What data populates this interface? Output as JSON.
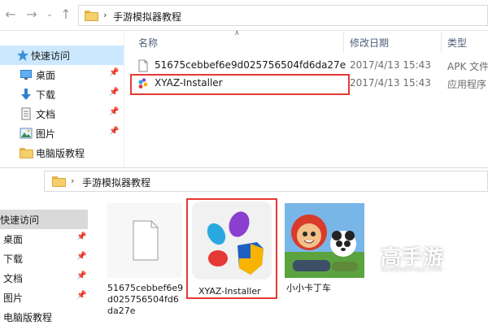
{
  "top_window": {
    "path": "手游模拟器教程",
    "nav": [
      {
        "label": "快速访问",
        "icon": "star-icon",
        "pinned": false
      },
      {
        "label": "桌面",
        "icon": "desktop-icon",
        "pinned": true
      },
      {
        "label": "下载",
        "icon": "download-icon",
        "pinned": true
      },
      {
        "label": "文档",
        "icon": "document-icon",
        "pinned": true
      },
      {
        "label": "图片",
        "icon": "picture-icon",
        "pinned": true
      },
      {
        "label": "电脑版教程",
        "icon": "folder-icon",
        "pinned": false
      }
    ],
    "columns": {
      "name": "名称",
      "date": "修改日期",
      "type": "类型"
    },
    "files": [
      {
        "name": "51675cebbef6e9d025756504fd6da27e",
        "date": "2017/4/13 15:43",
        "type": "APK 文件"
      },
      {
        "name": "XYAZ-Installer",
        "date": "2017/4/13 15:43",
        "type": "应用程序"
      }
    ]
  },
  "bottom_window": {
    "path": "手游模拟器教程",
    "nav": [
      {
        "label": "快速访问",
        "pinned": false
      },
      {
        "label": "桌面",
        "pinned": true
      },
      {
        "label": "下载",
        "pinned": true
      },
      {
        "label": "文档",
        "pinned": true
      },
      {
        "label": "图片",
        "pinned": true
      },
      {
        "label": "电脑版教程",
        "pinned": false
      }
    ],
    "tiles": [
      {
        "caption": "51675cebbef6e9d025756504fd6da27e"
      },
      {
        "caption": "XYAZ-Installer"
      },
      {
        "caption": "小小卡丁车"
      }
    ]
  },
  "watermark": {
    "brand": "高手游",
    "domain": "GAOSHOUYOU.COM"
  },
  "colors": {
    "highlight_red": "#e53935",
    "selection_blue": "#cce8ff",
    "folder_yellow": "#f4cf6a"
  }
}
